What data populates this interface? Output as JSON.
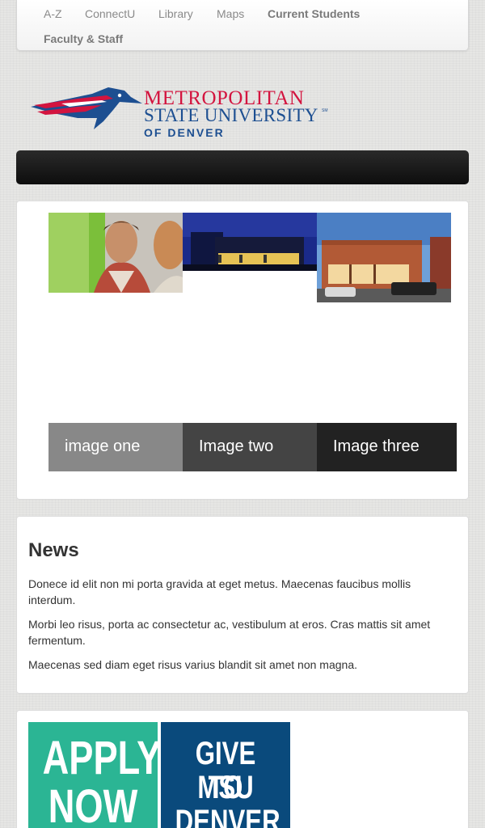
{
  "topnav": {
    "items": [
      "A-Z",
      "ConnectU",
      "Library",
      "Maps",
      "Current Students",
      "Faculty & Staff"
    ]
  },
  "logo": {
    "line1": "METROPOLITAN",
    "line2": "STATE UNIVERSITY",
    "line3": "OF DENVER",
    "mark": "SM",
    "colors": {
      "red": "#d3143f",
      "blue": "#1d4f91"
    }
  },
  "slider": {
    "captions": [
      "image one",
      "Image two",
      "Image three"
    ],
    "caption_colors": [
      "#888888",
      "#444444",
      "#222222"
    ]
  },
  "news": {
    "heading": "News",
    "paragraphs": [
      "Donece id elit non mi porta gravida at eget metus. Maecenas faucibus mollis interdum.",
      "Morbi leo risus, porta ac consectetur ac, vestibulum at eros. Cras mattis sit amet fermentum.",
      "Maecenas sed diam eget risus varius blandit sit amet non magna."
    ]
  },
  "promo": {
    "apply": {
      "line1": "APPLY",
      "line2": "NOW",
      "color": "#2bb594"
    },
    "give": {
      "line1": "GIVE TO",
      "line2": "MSU",
      "line3": "DENVER",
      "color": "#0a4a7c"
    }
  }
}
